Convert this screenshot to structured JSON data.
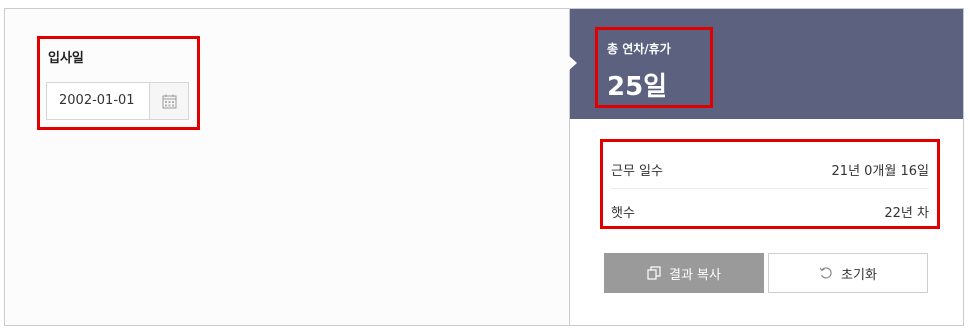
{
  "hire": {
    "label": "입사일",
    "date_value": "2002-01-01"
  },
  "result": {
    "total_label": "총 연차/휴가",
    "total_value": "25일",
    "rows": [
      {
        "key": "근무 일수",
        "value": "21년 0개월 16일"
      },
      {
        "key": "햇수",
        "value": "22년 차"
      }
    ]
  },
  "buttons": {
    "copy_label": "결과 복사",
    "reset_label": "초기화"
  },
  "colors": {
    "header_bg": "#5c6180",
    "highlight": "#e00000",
    "copy_button_bg": "#9a9a9a"
  },
  "icons": {
    "calendar": "calendar-icon",
    "copy": "copy-icon",
    "reset": "reset-icon"
  }
}
